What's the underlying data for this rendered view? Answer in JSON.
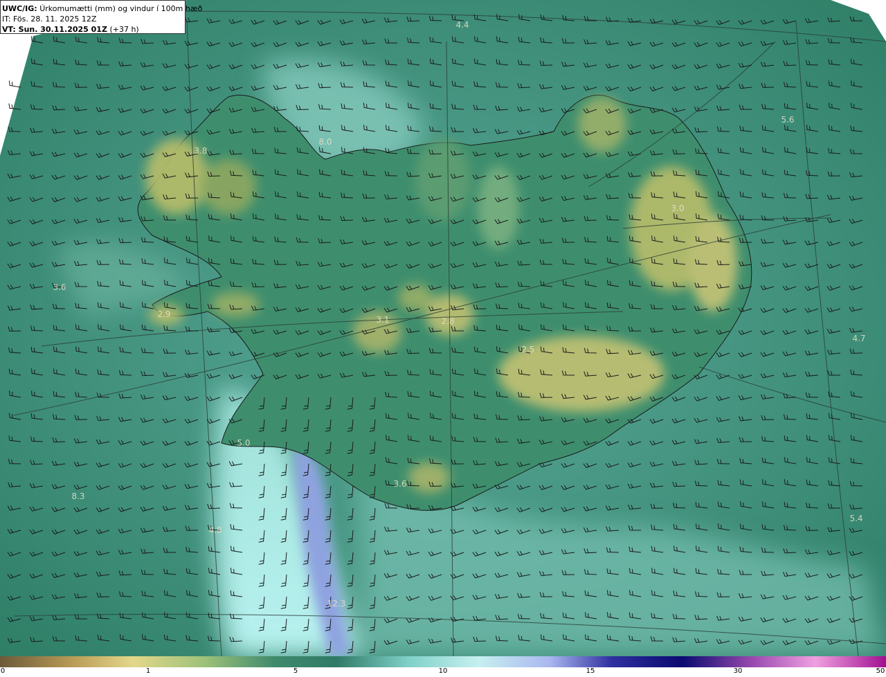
{
  "header": {
    "model": "UWC/IG:",
    "description": "Úrkomumætti (mm) og vindur í 100m hæð",
    "init_time": "IT: Fös. 28. 11. 2025 12Z",
    "valid_label": "VT: Sun. 30.11.2025 01Z",
    "valid_offset": "(+37 h)"
  },
  "map_labels": [
    {
      "text": "4.4"
    },
    {
      "text": "5.6"
    },
    {
      "text": "8.0"
    },
    {
      "text": "3.8"
    },
    {
      "text": "3.0"
    },
    {
      "text": "3.6"
    },
    {
      "text": "2.9"
    },
    {
      "text": "3.1"
    },
    {
      "text": "2.8"
    },
    {
      "text": "4.7"
    },
    {
      "text": "2.5"
    },
    {
      "text": "5.0"
    },
    {
      "text": "3.6"
    },
    {
      "text": "8.3"
    },
    {
      "text": "4.8"
    },
    {
      "text": "5.4"
    },
    {
      "text": "12.3"
    }
  ],
  "colorbar": {
    "ticks": [
      "0",
      "1",
      "5",
      "10",
      "15",
      "30",
      "50"
    ],
    "colors": [
      "#6b5a3a",
      "#b79a55",
      "#e3d78a",
      "#9ec27a",
      "#3f8a6c",
      "#2f7a66",
      "#7fd0c8",
      "#c6f0f0",
      "#aab8f0",
      "#3030a0",
      "#0a0a70",
      "#9a4ab0",
      "#f0a0e0",
      "#a01090"
    ]
  }
}
